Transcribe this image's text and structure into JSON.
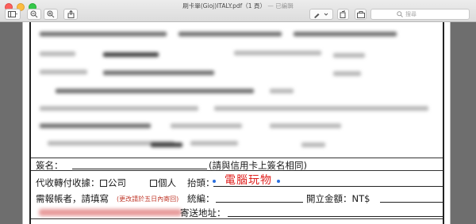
{
  "window": {
    "title": "刷卡單(Gioj)ITALY.pdf（1 頁）",
    "title_suffix": "— 已編輯"
  },
  "toolbar": {
    "search_placeholder": "搜尋",
    "sidebar_toggle_icon": "sidebar-icon",
    "zoom_out_icon": "zoom-out-icon",
    "zoom_in_icon": "zoom-in-icon",
    "share_icon": "share-icon",
    "markup_icon": "pen-icon",
    "rotate_icon": "rotate-icon",
    "toolbox_icon": "toolbox-icon"
  },
  "form": {
    "signature_label": "簽名：",
    "signature_note": "(請與信用卡上簽名相同)",
    "receipt_label": "代收轉付收據：",
    "option_company": "公司",
    "option_personal": "個人",
    "header_label": "抬頭：",
    "header_value": "電腦玩物",
    "reimburse_label": "需報帳者，請填寫",
    "reimburse_note": "(更改請於五日內寄回)",
    "tax_id_label": "統編：",
    "invoice_amount_label": "開立金額：NT$",
    "mailing_address_label": "寄送地址："
  }
}
